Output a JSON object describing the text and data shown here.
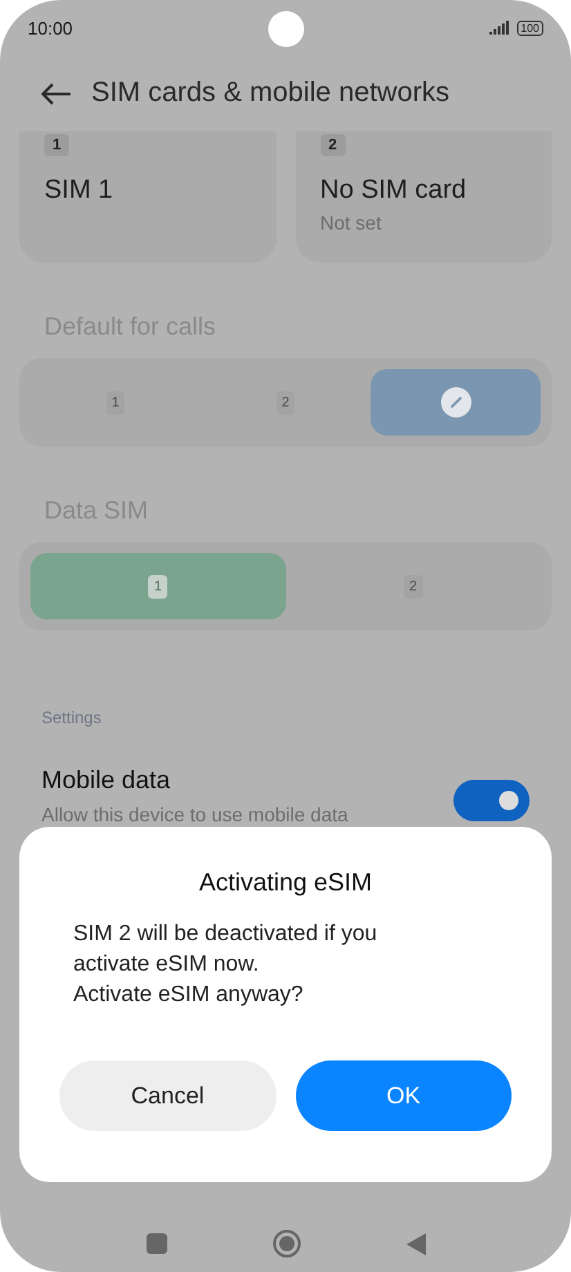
{
  "status_bar": {
    "time": "10:00",
    "battery": "100"
  },
  "header": {
    "title": "SIM cards & mobile networks"
  },
  "sim_cards": [
    {
      "slot": "1",
      "name": "SIM 1"
    },
    {
      "slot": "2",
      "name": "No SIM card",
      "status": "Not set"
    }
  ],
  "default_for_calls": {
    "label": "Default for calls",
    "options": [
      {
        "kind": "sim",
        "slot": "1",
        "selected": false
      },
      {
        "kind": "sim",
        "slot": "2",
        "selected": false
      },
      {
        "kind": "ask",
        "selected": true
      }
    ]
  },
  "data_sim": {
    "label": "Data SIM",
    "options": [
      {
        "kind": "sim",
        "slot": "1",
        "selected": true
      },
      {
        "kind": "sim",
        "slot": "2",
        "selected": false
      }
    ]
  },
  "settings": {
    "heading": "Settings",
    "mobile_data": {
      "title": "Mobile data",
      "subtitle": "Allow this device to use mobile data",
      "on": true
    }
  },
  "dialog": {
    "title": "Activating eSIM",
    "message": [
      "SIM 2 will be deactivated if you activate eSIM now.",
      "Activate eSIM anyway?"
    ],
    "buttons": [
      {
        "kind": "secondary",
        "label": "Cancel"
      },
      {
        "kind": "primary",
        "label": "OK"
      }
    ]
  }
}
